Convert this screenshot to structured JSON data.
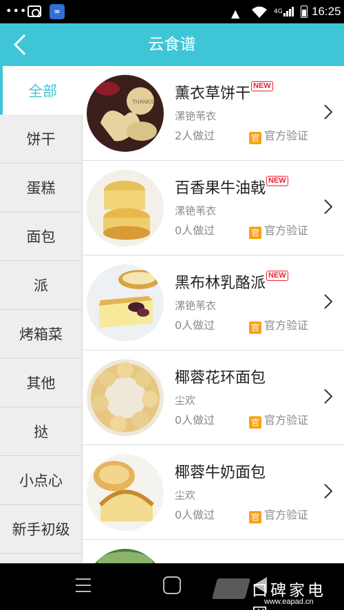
{
  "status_bar": {
    "dots": "•••",
    "network": "4G",
    "time": "16:25"
  },
  "header": {
    "title": "云食谱"
  },
  "sidebar": {
    "items": [
      {
        "label": "全部",
        "active": true
      },
      {
        "label": "饼干"
      },
      {
        "label": "蛋糕"
      },
      {
        "label": "面包"
      },
      {
        "label": "派"
      },
      {
        "label": "烤箱菜"
      },
      {
        "label": "其他"
      },
      {
        "label": "挞"
      },
      {
        "label": "小点心"
      },
      {
        "label": "新手初级"
      }
    ]
  },
  "recipes": [
    {
      "name": "薰衣草饼干",
      "new": "NEW",
      "author": "漯铯苇衣",
      "count": "2人做过",
      "badge": "官",
      "official": "官方验证"
    },
    {
      "name": "百香果牛油戟",
      "new": "NEW",
      "author": "漯铯苇衣",
      "count": "0人做过",
      "badge": "官",
      "official": "官方验证"
    },
    {
      "name": "黑布林乳酪派",
      "new": "NEW",
      "author": "漯铯苇衣",
      "count": "0人做过",
      "badge": "官",
      "official": "官方验证"
    },
    {
      "name": "椰蓉花环面包",
      "author": "尘欢",
      "count": "0人做过",
      "badge": "官",
      "official": "官方验证"
    },
    {
      "name": "椰蓉牛奶面包",
      "author": "尘欢",
      "count": "0人做过",
      "badge": "官",
      "official": "官方验证"
    }
  ],
  "watermark": {
    "name": "口碑家电网",
    "url": "www.eapad.cn"
  },
  "colors": {
    "accent": "#3ec6d6",
    "new_badge": "#e23333",
    "official_badge": "#f7a21c"
  },
  "icons": [
    "back-arrow-icon",
    "chevron-right-icon",
    "camera-icon",
    "wifi-icon",
    "signal-icon",
    "battery-icon",
    "menu-icon",
    "home-icon",
    "back-key-icon"
  ]
}
